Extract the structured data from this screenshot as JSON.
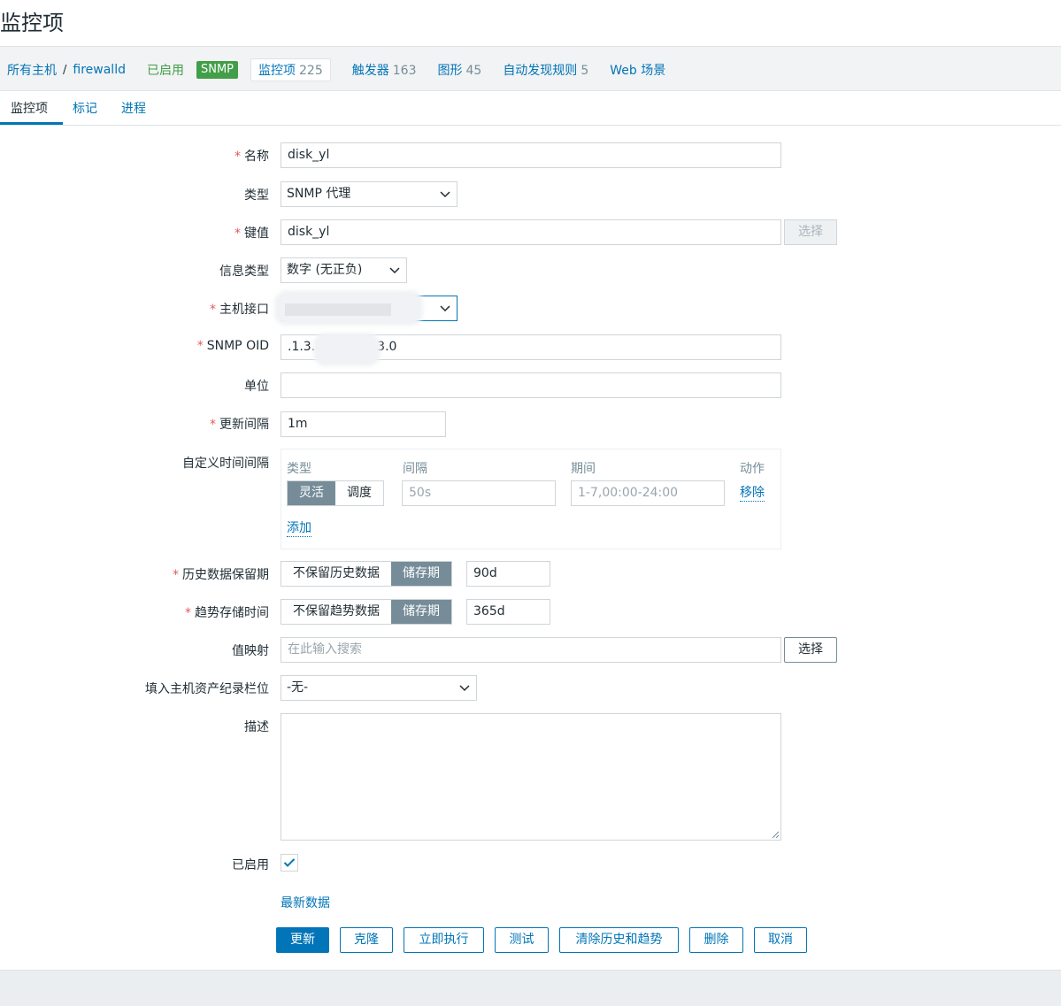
{
  "page": {
    "title": "监控项"
  },
  "host_nav": {
    "all_hosts": "所有主机",
    "separator": "/",
    "host": "firewalld",
    "status": "已启用",
    "snmp_badge": "SNMP",
    "items": {
      "label": "监控项",
      "count": "225"
    },
    "triggers": {
      "label": "触发器",
      "count": "163"
    },
    "graphs": {
      "label": "图形",
      "count": "45"
    },
    "discovery": {
      "label": "自动发现规则",
      "count": "5"
    },
    "web": {
      "label": "Web 场景"
    }
  },
  "tabs": [
    "监控项",
    "标记",
    "进程"
  ],
  "form": {
    "name": {
      "label": "名称",
      "value": "disk_yl"
    },
    "type": {
      "label": "类型",
      "value": "SNMP 代理"
    },
    "key": {
      "label": "键值",
      "value": "disk_yl",
      "select_button": "选择"
    },
    "info_type": {
      "label": "信息类型",
      "value": "数字 (无正负)"
    },
    "host_interface": {
      "label": "主机接口",
      "value": ""
    },
    "snmp_oid": {
      "label": "SNMP OID",
      "value_prefix": ".1.3.",
      "value_suffix": "3.0"
    },
    "units": {
      "label": "单位",
      "value": ""
    },
    "update_interval": {
      "label": "更新间隔",
      "value": "1m"
    },
    "custom_intervals": {
      "label": "自定义时间间隔",
      "headers": {
        "type": "类型",
        "interval": "间隔",
        "period": "期间",
        "action": "动作"
      },
      "type_options": [
        "灵活",
        "调度"
      ],
      "selected_type": "灵活",
      "interval_placeholder": "50s",
      "period_placeholder": "1-7,00:00-24:00",
      "remove": "移除",
      "add": "添加"
    },
    "history": {
      "label": "历史数据保留期",
      "opt_off": "不保留历史数据",
      "opt_on": "储存期",
      "value": "90d"
    },
    "trends": {
      "label": "趋势存储时间",
      "opt_off": "不保留趋势数据",
      "opt_on": "储存期",
      "value": "365d"
    },
    "value_map": {
      "label": "值映射",
      "placeholder": "在此输入搜索",
      "select_button": "选择"
    },
    "inventory": {
      "label": "填入主机资产纪录栏位",
      "value": "-无-"
    },
    "description": {
      "label": "描述",
      "value": ""
    },
    "enabled": {
      "label": "已启用",
      "checked": true
    },
    "latest_data": "最新数据"
  },
  "buttons": {
    "update": "更新",
    "clone": "克隆",
    "execute_now": "立即执行",
    "test": "测试",
    "clear_history": "清除历史和趋势",
    "delete": "删除",
    "cancel": "取消"
  },
  "colors": {
    "link": "#0275b8",
    "required": "#e45959",
    "enabled_green": "#429e47",
    "segment_on": "#768d99"
  }
}
